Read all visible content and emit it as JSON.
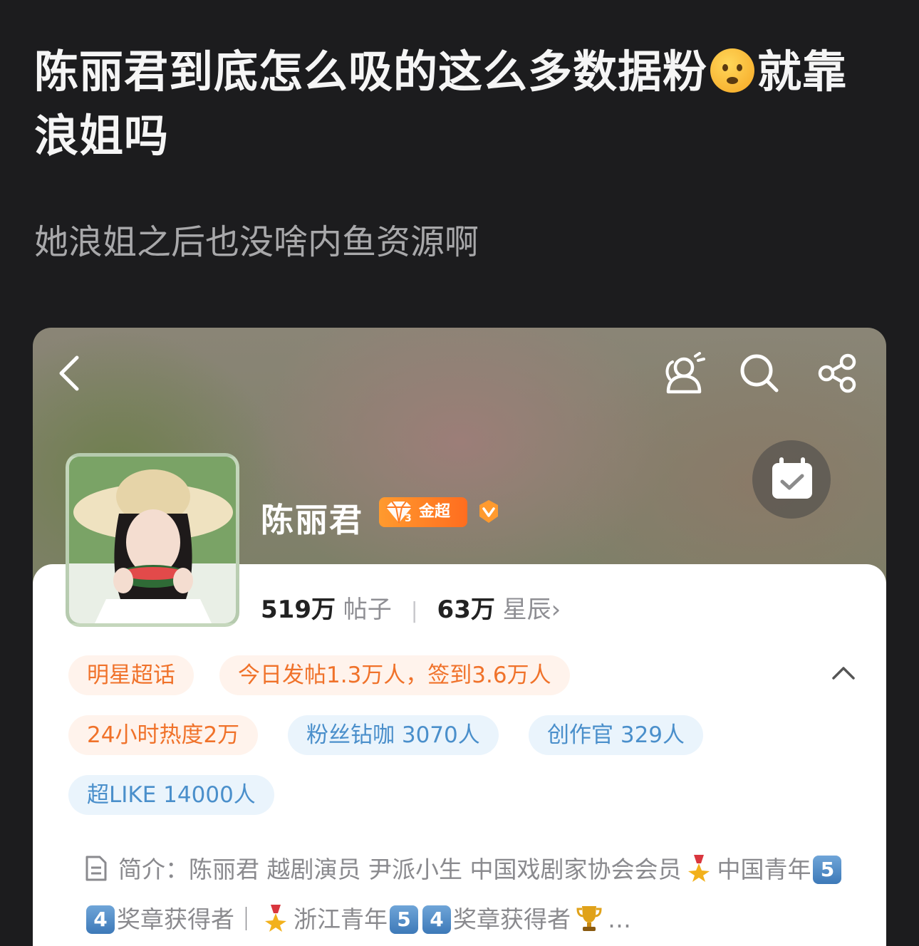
{
  "post": {
    "title_part1": "陈丽君到底怎么吸的这么多数据粉",
    "title_part2": "就靠浪姐吗",
    "body": "她浪姐之后也没啥内鱼资源啊",
    "emoji_name": "anxious-face-emoji"
  },
  "profile": {
    "name": "陈丽君",
    "badge_label": "金超",
    "badge_level": "3",
    "stats": {
      "posts_value": "519万",
      "posts_label": "帖子",
      "stars_value": "63万",
      "stars_label": "星辰",
      "stars_chevron": "›"
    },
    "chips": [
      {
        "label": "明星超话",
        "tone": "orange"
      },
      {
        "label": "今日发帖1.3万人，签到3.6万人",
        "tone": "orange"
      },
      {
        "label": "24小时热度2万",
        "tone": "orange"
      },
      {
        "label": "粉丝钻咖 3070人",
        "tone": "blue"
      },
      {
        "label": "创作官 329人",
        "tone": "blue"
      },
      {
        "label": "超LIKE 14000人",
        "tone": "blue"
      }
    ],
    "intro": {
      "seg1": "简介：陈丽君 越剧演员 尹派小生 中国戏剧家协会会员",
      "seg2": "中国青年",
      "seg3": "奖章获得者｜",
      "seg4": "浙江青年",
      "seg5": "奖章获得者",
      "seg6": "…",
      "key5": "5",
      "key4": "4"
    }
  },
  "colors": {
    "page_bg": "#1c1c1e",
    "chip_orange_text": "#f0722a",
    "chip_blue_text": "#4a8fcb",
    "badge_gold": "#ff7a22"
  },
  "icons": [
    "back-icon",
    "super-topic-people-icon",
    "search-icon",
    "share-icon",
    "calendar-check-icon",
    "verified-v-icon",
    "collapse-up-icon",
    "document-icon",
    "medal-icon",
    "trophy-icon"
  ]
}
